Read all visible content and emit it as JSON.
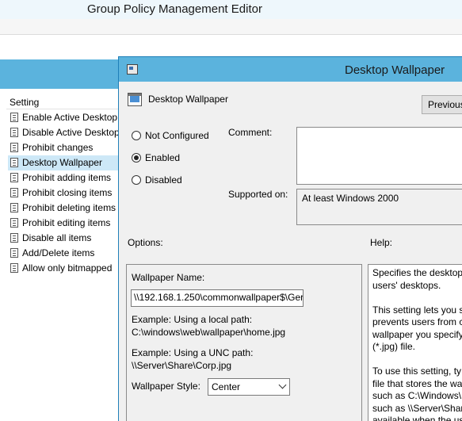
{
  "app": {
    "title": "Group Policy Management Editor"
  },
  "settings_list": {
    "header": "Setting",
    "items": [
      {
        "label": "Enable Active Desktop",
        "selected": false
      },
      {
        "label": "Disable Active Desktop",
        "selected": false
      },
      {
        "label": "Prohibit changes",
        "selected": false
      },
      {
        "label": "Desktop Wallpaper",
        "selected": true
      },
      {
        "label": "Prohibit adding items",
        "selected": false
      },
      {
        "label": "Prohibit closing items",
        "selected": false
      },
      {
        "label": "Prohibit deleting items",
        "selected": false
      },
      {
        "label": "Prohibit editing items",
        "selected": false
      },
      {
        "label": "Disable all items",
        "selected": false
      },
      {
        "label": "Add/Delete items",
        "selected": false
      },
      {
        "label": "Allow only bitmapped",
        "selected": false
      }
    ]
  },
  "dialog": {
    "title": "Desktop Wallpaper",
    "policy_name": "Desktop Wallpaper",
    "previous_button": "Previous",
    "state": {
      "not_configured": "Not Configured",
      "enabled": "Enabled",
      "disabled": "Disabled",
      "selected": "enabled"
    },
    "comment_label": "Comment:",
    "comment_value": "",
    "supported_label": "Supported on:",
    "supported_value": "At least Windows 2000",
    "options_label": "Options:",
    "help_label": "Help:",
    "options": {
      "wallpaper_name_label": "Wallpaper Name:",
      "wallpaper_name_value": "\\\\192.168.1.250\\commonwallpaper$\\Ger",
      "example_local_label": "Example: Using a local path:",
      "example_local_value": "C:\\windows\\web\\wallpaper\\home.jpg",
      "example_unc_label": "Example: Using a UNC path:",
      "example_unc_value": "\\\\Server\\Share\\Corp.jpg",
      "style_label": "Wallpaper Style:",
      "style_value": "Center"
    },
    "help_lines": [
      "Specifies the desktop",
      "users' desktops.",
      "",
      "This setting lets you s",
      "prevents users from c",
      "wallpaper you specify",
      "(*.jpg) file.",
      "",
      "To use this setting, ty",
      "file that stores the wa",
      "such as C:\\Windows\\",
      "such as \\\\Server\\Shar",
      "available when the us"
    ]
  }
}
